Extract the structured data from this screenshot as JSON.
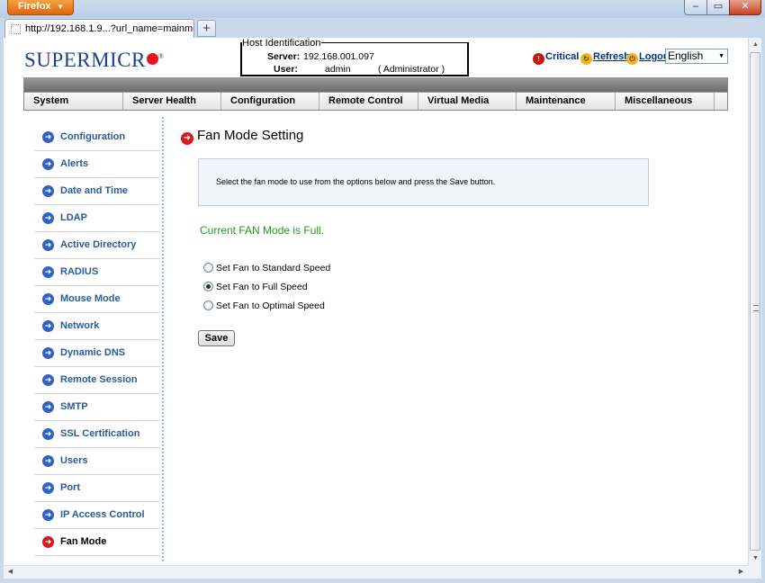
{
  "browser": {
    "app_button": "Firefox",
    "tab_title": "http://192.168.1.9...?url_name=mainmenu",
    "new_tab": "+",
    "window_controls": {
      "minimize": "–",
      "maximize": "▭",
      "close": "✕"
    }
  },
  "header": {
    "logo_text": "SUPERMICR",
    "logo_reg": "®",
    "host_identification": {
      "legend": "Host Identification",
      "server_label": "Server:",
      "server_value": "192.168.001.097",
      "user_label": "User:",
      "user_value": "admin",
      "role": "( Administrator )"
    },
    "links": {
      "critical": "Critical",
      "refresh": "Refresh",
      "logout": "Logout"
    },
    "language": "English"
  },
  "menu": [
    "System",
    "Server Health",
    "Configuration",
    "Remote Control",
    "Virtual Media",
    "Maintenance",
    "Miscellaneous"
  ],
  "sidebar": {
    "items": [
      "Configuration",
      "Alerts",
      "Date and Time",
      "LDAP",
      "Active Directory",
      "RADIUS",
      "Mouse Mode",
      "Network",
      "Dynamic DNS",
      "Remote Session",
      "SMTP",
      "SSL Certification",
      "Users",
      "Port",
      "IP Access Control",
      "Fan Mode"
    ],
    "active": "Fan Mode"
  },
  "main": {
    "title": "Fan Mode Setting",
    "instructions": "Select the fan mode to use from the options below and press the Save button.",
    "current_mode": "Current FAN Mode is Full.",
    "options": [
      {
        "label": "Set Fan to Standard Speed",
        "selected": false
      },
      {
        "label": "Set Fan to Full Speed",
        "selected": true
      },
      {
        "label": "Set Fan to Optimal Speed",
        "selected": false
      }
    ],
    "save_label": "Save"
  },
  "colors": {
    "brand_blue": "#1c3f94",
    "brand_red": "#e8141d",
    "link_blue": "#2a5a9c",
    "status_green": "#1f9a18"
  },
  "icons": {
    "nav_arrow": "arrow-right-circle-icon",
    "critical": "alert-icon",
    "refresh": "refresh-icon",
    "logout": "logout-icon"
  }
}
